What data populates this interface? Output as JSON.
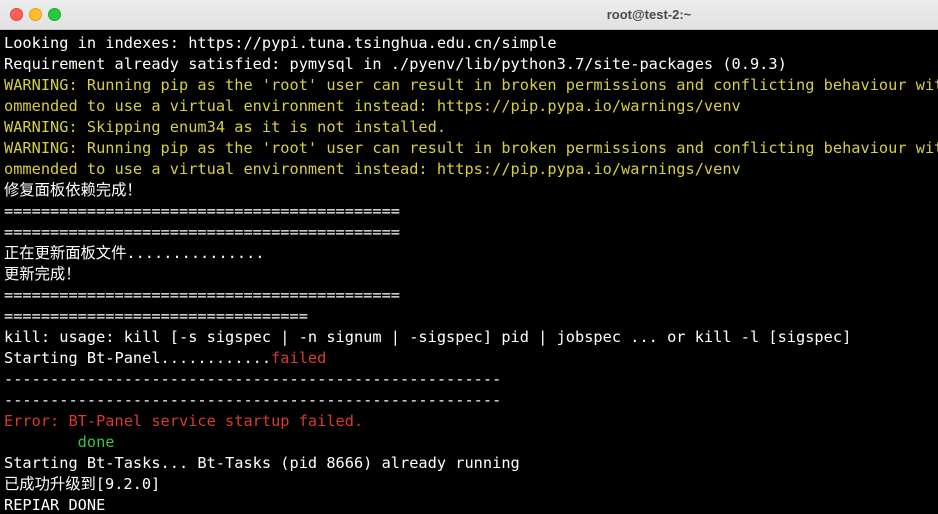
{
  "window": {
    "title": "root@test-2:~"
  },
  "colors": {
    "white": "#ffffff",
    "yellow": "#d7cf3c",
    "red": "#d83a32",
    "green": "#3cc43c",
    "background": "#000000"
  },
  "terminal": {
    "lines": [
      [
        {
          "text": "Looking in indexes: https://pypi.tuna.tsinghua.edu.cn/simple",
          "color": "white"
        }
      ],
      [
        {
          "text": "Requirement already satisfied: pymysql in ./pyenv/lib/python3.7/site-packages (0.9.3)",
          "color": "white"
        }
      ],
      [
        {
          "text": "WARNING: Running pip as the 'root' user can result in broken permissions and conflicting behaviour with",
          "color": "yellow"
        }
      ],
      [
        {
          "text": "ommended to use a virtual environment instead: https://pip.pypa.io/warnings/venv",
          "color": "yellow"
        }
      ],
      [
        {
          "text": "WARNING: Skipping enum34 as it is not installed.",
          "color": "yellow"
        }
      ],
      [
        {
          "text": "WARNING: Running pip as the 'root' user can result in broken permissions and conflicting behaviour with",
          "color": "yellow"
        }
      ],
      [
        {
          "text": "ommended to use a virtual environment instead: https://pip.pypa.io/warnings/venv",
          "color": "yellow"
        }
      ],
      [
        {
          "text": "修复面板依赖完成！",
          "color": "white"
        }
      ],
      [
        {
          "text": "===========================================",
          "color": "white"
        }
      ],
      [
        {
          "text": "===========================================",
          "color": "white"
        }
      ],
      [
        {
          "text": "正在更新面板文件...............",
          "color": "white"
        }
      ],
      [
        {
          "text": "更新完成！",
          "color": "white"
        }
      ],
      [
        {
          "text": "===========================================",
          "color": "white"
        }
      ],
      [
        {
          "text": "=================================",
          "color": "white"
        }
      ],
      [
        {
          "text": "kill: usage: kill [-s sigspec | -n signum | -sigspec] pid | jobspec ... or kill -l [sigspec]",
          "color": "white"
        }
      ],
      [
        {
          "text": "Starting Bt-Panel............",
          "color": "white"
        },
        {
          "text": "failed",
          "color": "red"
        }
      ],
      [
        {
          "text": "------------------------------------------------------",
          "color": "white"
        }
      ],
      [
        {
          "text": "------------------------------------------------------",
          "color": "white"
        }
      ],
      [
        {
          "text": "Error: BT-Panel service startup failed.",
          "color": "red"
        }
      ],
      [
        {
          "text": "        done",
          "color": "green"
        }
      ],
      [
        {
          "text": "Starting Bt-Tasks... Bt-Tasks (pid 8666) already running",
          "color": "white"
        }
      ],
      [
        {
          "text": "已成功升级到[9.2.0]",
          "color": "white"
        }
      ],
      [
        {
          "text": "REPIAR DONE",
          "color": "white"
        }
      ]
    ]
  }
}
